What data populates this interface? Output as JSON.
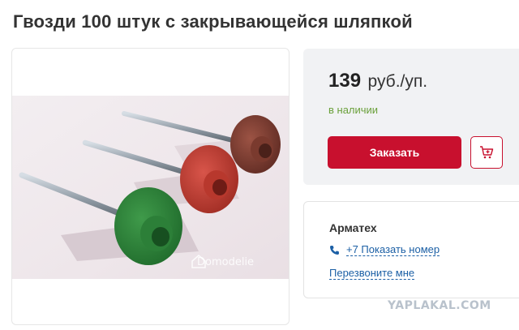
{
  "product": {
    "title": "Гвозди 100 штук с закрывающейся шляпкой",
    "image_watermark": "Domodelie"
  },
  "pricing": {
    "price": "139",
    "unit": "руб./уп.",
    "availability": "в наличии",
    "order_label": "Заказать",
    "cart_icon": "cart-plus-icon"
  },
  "seller": {
    "name": "Арматех",
    "phone_icon": "phone-icon",
    "phone_label": "+7 Показать номер",
    "callback_label": "Перезвоните мне"
  },
  "site_watermark": "YAPLAKAL.COM",
  "colors": {
    "accent": "#c8102e",
    "link": "#1b5fa5",
    "availability": "#6aa03a"
  }
}
